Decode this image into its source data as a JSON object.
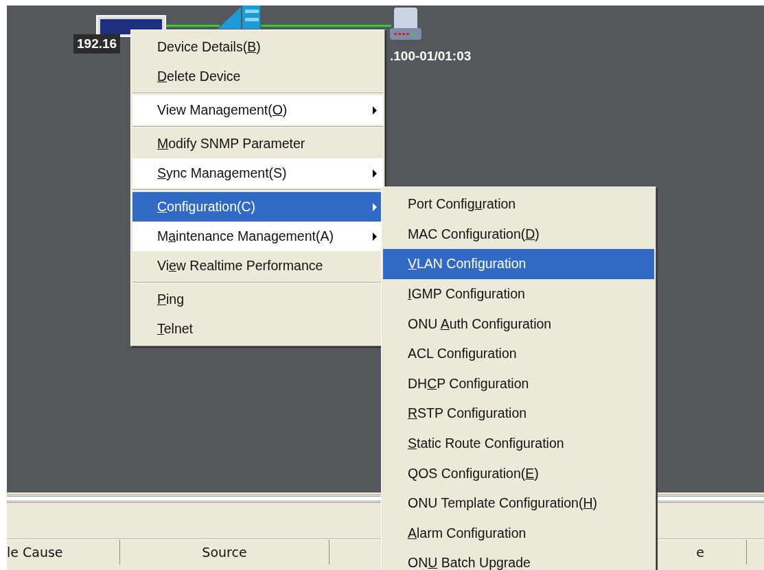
{
  "topology": {
    "devices": [
      {
        "kind": "olt",
        "label": "192.16"
      },
      {
        "kind": "switch"
      },
      {
        "kind": "onu",
        "label": ".100-01/01:03"
      }
    ]
  },
  "context_menu": {
    "groups": [
      [
        {
          "pre": "Device Details(",
          "key": "B",
          "post": ")",
          "kind": "command",
          "selected": false
        },
        {
          "key": "D",
          "post": "elete Device",
          "kind": "command",
          "selected": false
        }
      ],
      [
        {
          "pre": "View Management(",
          "key": "O",
          "post": ")",
          "kind": "submenu",
          "selected": false
        }
      ],
      [
        {
          "key": "M",
          "post": "odify SNMP Parameter",
          "kind": "command",
          "selected": false
        },
        {
          "key": "S",
          "post": "ync Management(S)",
          "kind": "submenu",
          "selected": false
        }
      ],
      [
        {
          "key": "C",
          "post": "onfiguration(C)",
          "kind": "submenu",
          "selected": true
        },
        {
          "pre": "M",
          "key": "a",
          "post": "intenance Management(A)",
          "kind": "submenu",
          "selected": false
        },
        {
          "pre": "Vi",
          "key": "e",
          "post": "w Realtime Performance",
          "kind": "command",
          "selected": false
        }
      ],
      [
        {
          "key": "P",
          "post": "ing",
          "kind": "command",
          "selected": false
        },
        {
          "key": "T",
          "post": "elnet",
          "kind": "command",
          "selected": false
        }
      ]
    ]
  },
  "submenu": {
    "items": [
      {
        "pre": "Port Config",
        "key": "u",
        "post": "ration",
        "selected": false
      },
      {
        "pre": "MAC Configuration(",
        "key": "D",
        "post": ")",
        "selected": false
      },
      {
        "key": "V",
        "post": "LAN Configuration",
        "selected": true
      },
      {
        "key": "I",
        "post": "GMP Configuration",
        "selected": false
      },
      {
        "pre": "ONU ",
        "key": "A",
        "post": "uth Configuration",
        "selected": false
      },
      {
        "pre": "ACL Configuration",
        "selected": false
      },
      {
        "pre": "DH",
        "key": "C",
        "post": "P Configuration",
        "selected": false
      },
      {
        "key": "R",
        "post": "STP Configuration",
        "selected": false
      },
      {
        "key": "S",
        "post": "tatic Route Configuration",
        "selected": false
      },
      {
        "pre": "QOS Configuration(",
        "key": "E",
        "post": ")",
        "selected": false
      },
      {
        "pre": "ONU Template Configuration(",
        "key": "H",
        "post": ")",
        "selected": false
      },
      {
        "key": "A",
        "post": "larm Configuration",
        "selected": false
      },
      {
        "pre": "ON",
        "key": "U",
        "post": " Batch Upgrade",
        "selected": false
      }
    ]
  },
  "alarm_table": {
    "columns": [
      "le Cause",
      "Source",
      "e"
    ]
  }
}
